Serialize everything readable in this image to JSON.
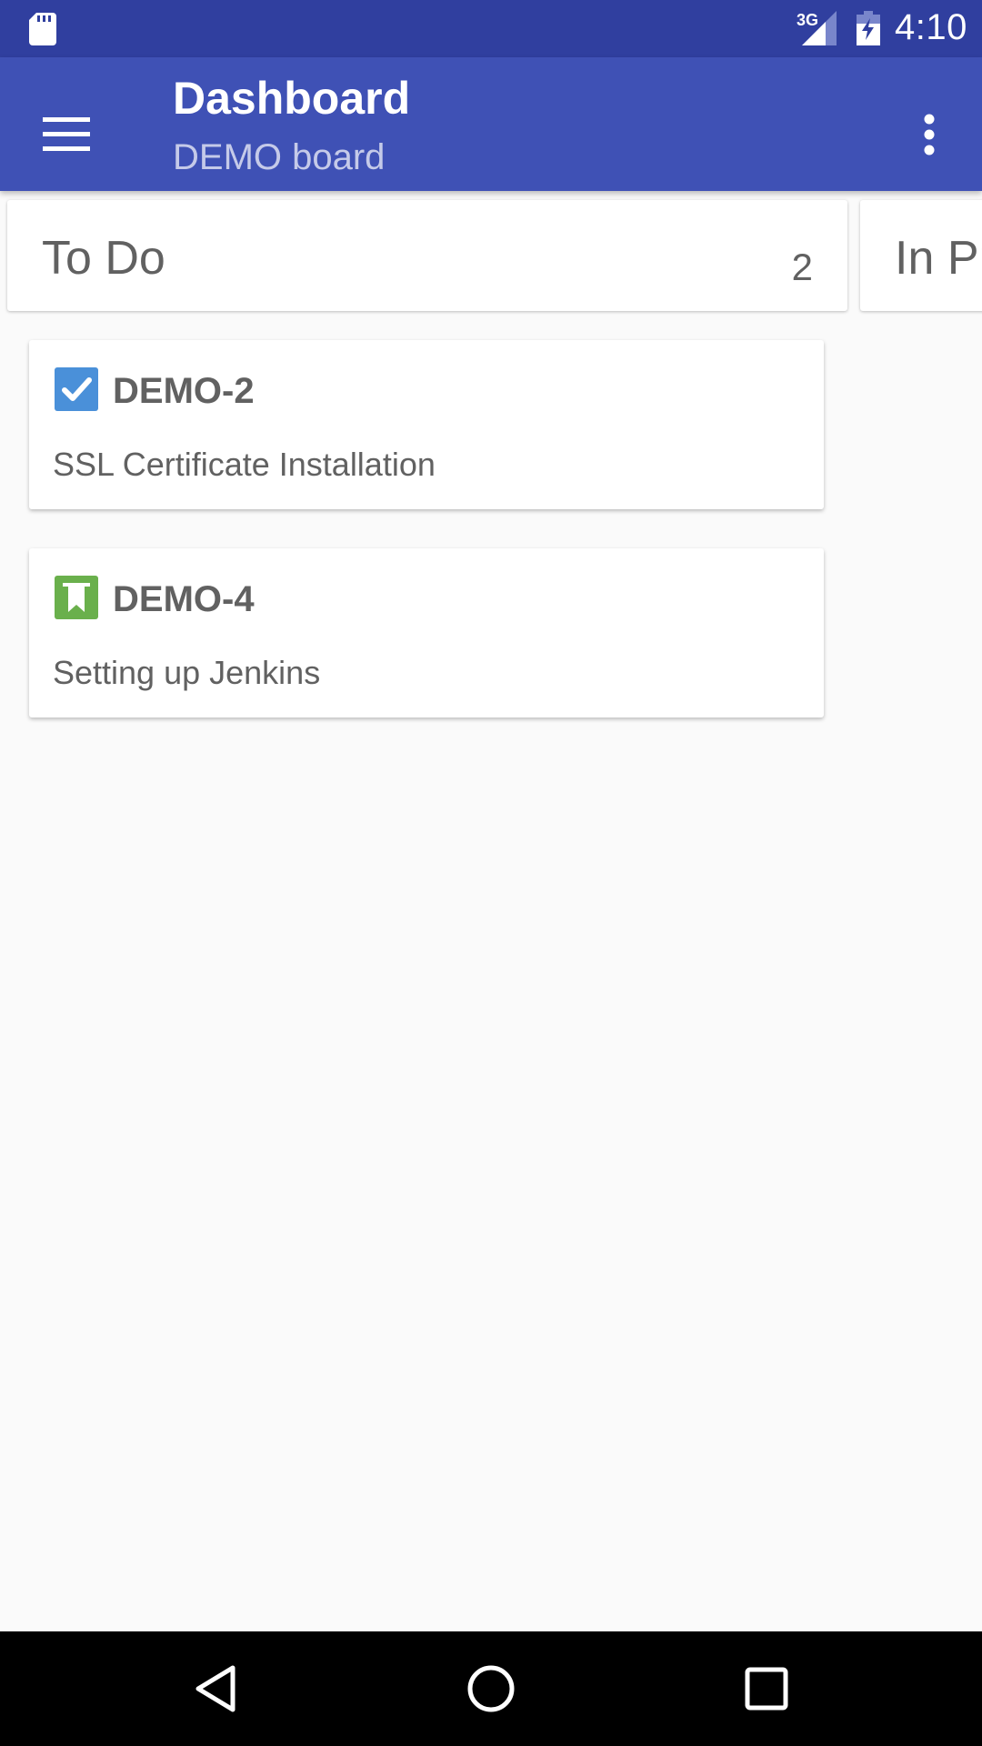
{
  "status_bar": {
    "network_type": "3G",
    "time": "4:10"
  },
  "app_bar": {
    "title": "Dashboard",
    "subtitle": "DEMO board"
  },
  "columns": [
    {
      "title": "To Do",
      "count": "2"
    },
    {
      "title": "In Pr",
      "count": ""
    }
  ],
  "issues": [
    {
      "key": "DEMO-2",
      "summary": "SSL Certificate Installation",
      "type_icon": "task-checkbox-icon",
      "type_color": "#4a90d9"
    },
    {
      "key": "DEMO-4",
      "summary": "Setting up Jenkins",
      "type_icon": "story-bookmark-icon",
      "type_color": "#6ab04c"
    }
  ],
  "colors": {
    "status_bar": "#303f9f",
    "app_bar": "#3f51b5",
    "subtitle": "#c5cae9",
    "background": "#fafafa"
  }
}
